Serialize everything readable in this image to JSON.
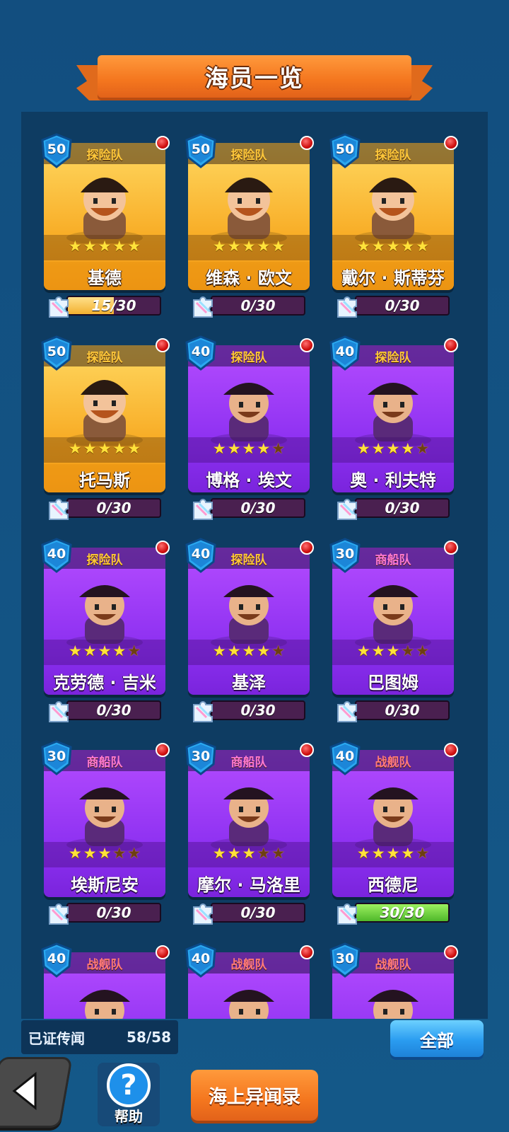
{
  "title": "海员一览",
  "cards": [
    {
      "name": "基德",
      "team": "探险队",
      "level": "50",
      "stars": 5,
      "max_stars": 5,
      "progress": "15/30",
      "progress_fraction": 0.5,
      "rarity": "gold",
      "team_type": "explore"
    },
    {
      "name": "维森 · 欧文",
      "team": "探险队",
      "level": "50",
      "stars": 5,
      "max_stars": 5,
      "progress": "0/30",
      "progress_fraction": 0,
      "rarity": "gold",
      "team_type": "explore"
    },
    {
      "name": "戴尔 · 斯蒂芬",
      "team": "探险队",
      "level": "50",
      "stars": 5,
      "max_stars": 5,
      "progress": "0/30",
      "progress_fraction": 0,
      "rarity": "gold",
      "team_type": "explore"
    },
    {
      "name": "托马斯",
      "team": "探险队",
      "level": "50",
      "stars": 5,
      "max_stars": 5,
      "progress": "0/30",
      "progress_fraction": 0,
      "rarity": "gold",
      "team_type": "explore"
    },
    {
      "name": "博格 · 埃文",
      "team": "探险队",
      "level": "40",
      "stars": 4,
      "max_stars": 5,
      "progress": "0/30",
      "progress_fraction": 0,
      "rarity": "purple",
      "team_type": "explore"
    },
    {
      "name": "奥 · 利夫特",
      "team": "探险队",
      "level": "40",
      "stars": 4,
      "max_stars": 5,
      "progress": "0/30",
      "progress_fraction": 0,
      "rarity": "purple",
      "team_type": "explore"
    },
    {
      "name": "克劳德 · 吉米",
      "team": "探险队",
      "level": "40",
      "stars": 4,
      "max_stars": 5,
      "progress": "0/30",
      "progress_fraction": 0,
      "rarity": "purple",
      "team_type": "explore"
    },
    {
      "name": "基泽",
      "team": "探险队",
      "level": "40",
      "stars": 4,
      "max_stars": 5,
      "progress": "0/30",
      "progress_fraction": 0,
      "rarity": "purple",
      "team_type": "explore"
    },
    {
      "name": "巴图姆",
      "team": "商船队",
      "level": "30",
      "stars": 3,
      "max_stars": 5,
      "progress": "0/30",
      "progress_fraction": 0,
      "rarity": "purple",
      "team_type": "merchant"
    },
    {
      "name": "埃斯尼安",
      "team": "商船队",
      "level": "30",
      "stars": 3,
      "max_stars": 5,
      "progress": "0/30",
      "progress_fraction": 0,
      "rarity": "purple",
      "team_type": "merchant"
    },
    {
      "name": "摩尔 · 马洛里",
      "team": "商船队",
      "level": "30",
      "stars": 3,
      "max_stars": 5,
      "progress": "0/30",
      "progress_fraction": 0,
      "rarity": "purple",
      "team_type": "merchant"
    },
    {
      "name": "西德尼",
      "team": "战舰队",
      "level": "40",
      "stars": 4,
      "max_stars": 5,
      "progress": "30/30",
      "progress_fraction": 1,
      "rarity": "purple",
      "team_type": "warship"
    },
    {
      "name": "",
      "team": "战舰队",
      "level": "40",
      "stars": 0,
      "max_stars": 0,
      "progress": "",
      "progress_fraction": 0,
      "rarity": "purple",
      "team_type": "warship"
    },
    {
      "name": "",
      "team": "战舰队",
      "level": "40",
      "stars": 0,
      "max_stars": 0,
      "progress": "",
      "progress_fraction": 0,
      "rarity": "purple",
      "team_type": "warship"
    },
    {
      "name": "",
      "team": "战舰队",
      "level": "30",
      "stars": 0,
      "max_stars": 0,
      "progress": "",
      "progress_fraction": 0,
      "rarity": "purple",
      "team_type": "warship"
    }
  ],
  "legend": {
    "label": "已证传闻",
    "count": "58/58"
  },
  "filter_button": "全部",
  "help": {
    "icon": "?",
    "label": "帮助"
  },
  "record_button": "海上异闻录",
  "icons": {
    "back": "back-arrow-icon",
    "puzzle": "puzzle-piece-icon",
    "level": "shield-level-icon",
    "notify": "red-dot-icon",
    "help": "question-icon"
  },
  "colors": {
    "gold": "#f7a820",
    "purple": "#8b2ff0",
    "accent": "#f4761e",
    "button_blue": "#2a9cf0"
  }
}
